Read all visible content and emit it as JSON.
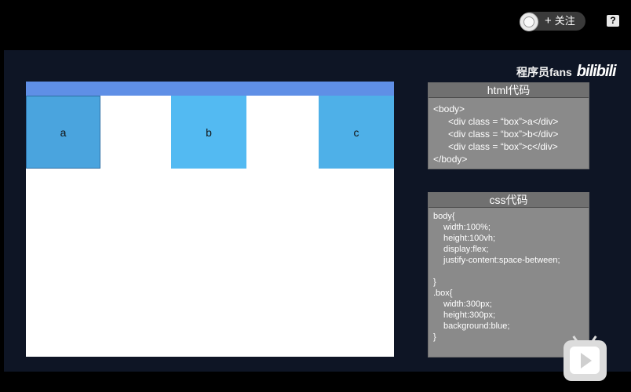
{
  "topbar": {
    "follow_label": "关注",
    "follow_plus": "+",
    "help_label": "?"
  },
  "watermark": {
    "channel": "程序员fans",
    "site_logo": "bilibili"
  },
  "demo": {
    "boxes": [
      "a",
      "b",
      "c"
    ],
    "colors": {
      "bar": "#5f8fe6",
      "box": "#4eb0e8"
    }
  },
  "html_panel": {
    "title": "html代码",
    "lines": [
      "<body>",
      "<div class = “box”>a</div>",
      "<div class = “box”>b</div>",
      "<div class = “box”>c</div>",
      "</body>"
    ]
  },
  "css_panel": {
    "title": "css代码",
    "lines": [
      "body{",
      "width:100%;",
      "height:100vh;",
      "display:flex;",
      "justify-content:space-between;",
      "}",
      ".box{",
      "width:300px;",
      "height:300px;",
      "background:blue;",
      "}"
    ]
  },
  "icons": {
    "avatar": "avatar-icon",
    "help": "help-icon",
    "tv": "bilibili-tv-icon"
  }
}
